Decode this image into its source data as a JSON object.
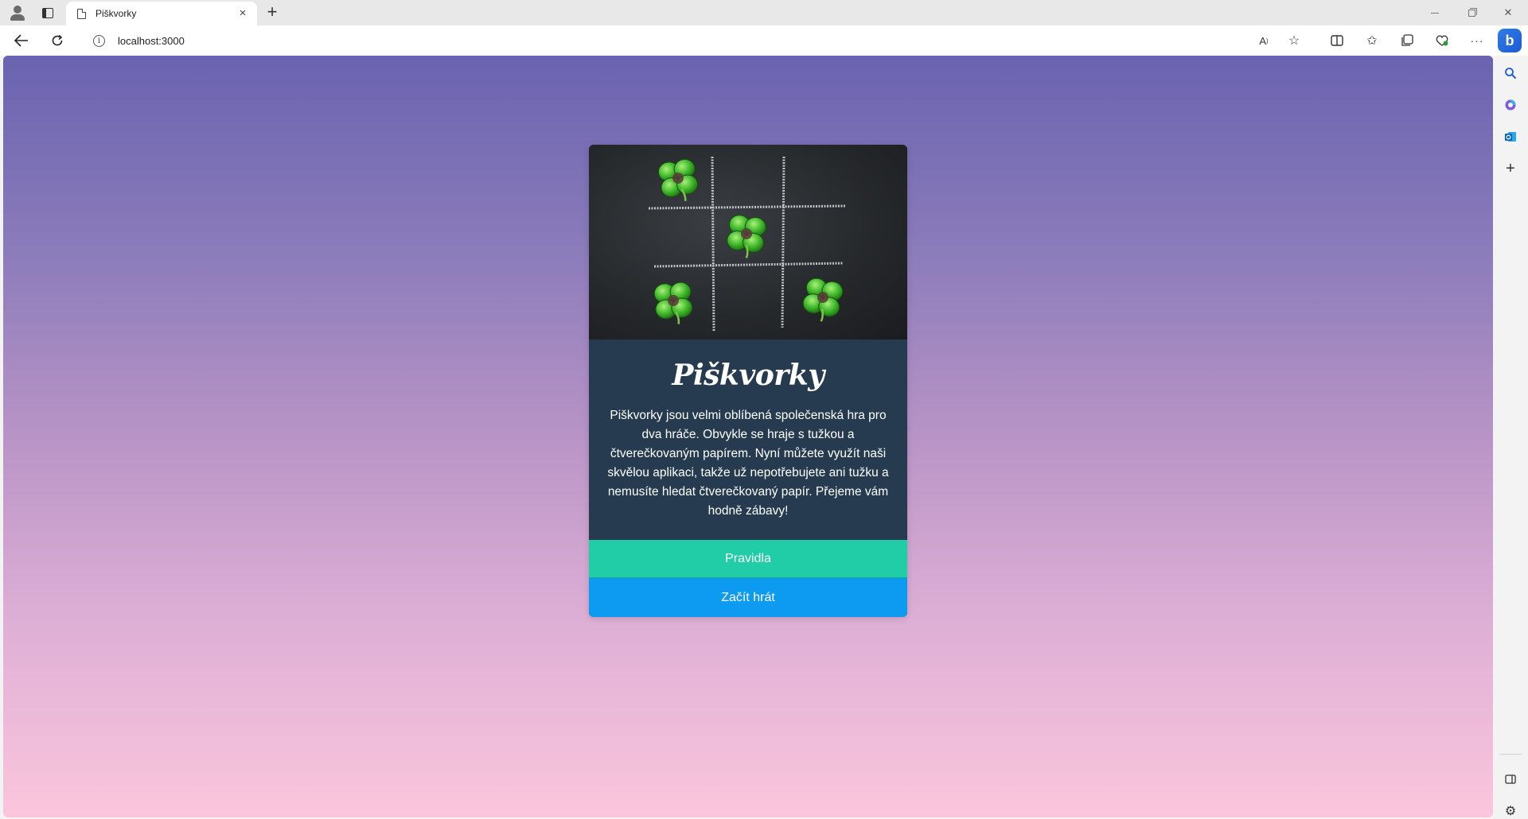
{
  "browser": {
    "tab_title": "Piškvorky",
    "tab_close": "×",
    "new_tab": "+",
    "address": "localhost:3000"
  },
  "page": {
    "title": "Piškvorky",
    "description": "Piškvorky jsou velmi oblíbená společenská hra pro dva hráče. Obvykle se hraje s tužkou a čtverečkovaným papírem. Nyní můžete využít naši skvělou aplikaci, takže už nepotřebujete ani tužku a nemusíte hledat čtverečkovaný papír. Přejeme vám hodně zábavy!",
    "rules_button": "Pravidla",
    "play_button": "Začít hrát"
  },
  "colors": {
    "gradient_top": "#6a63b0",
    "gradient_bottom": "#fbc6dc",
    "card_bg": "#263b50",
    "rules_button": "#20cda6",
    "play_button": "#0d9bf1"
  },
  "icons": {
    "toolbar": [
      "read-aloud-icon",
      "favorite-star-icon",
      "split-screen-icon",
      "favorites-icon",
      "collections-icon",
      "browser-essentials-icon",
      "more-icon"
    ],
    "sidebar": [
      "bing-copilot-icon",
      "search-icon",
      "office-icon",
      "outlook-icon",
      "add-icon",
      "sidebar-toggle-icon",
      "settings-icon"
    ]
  }
}
